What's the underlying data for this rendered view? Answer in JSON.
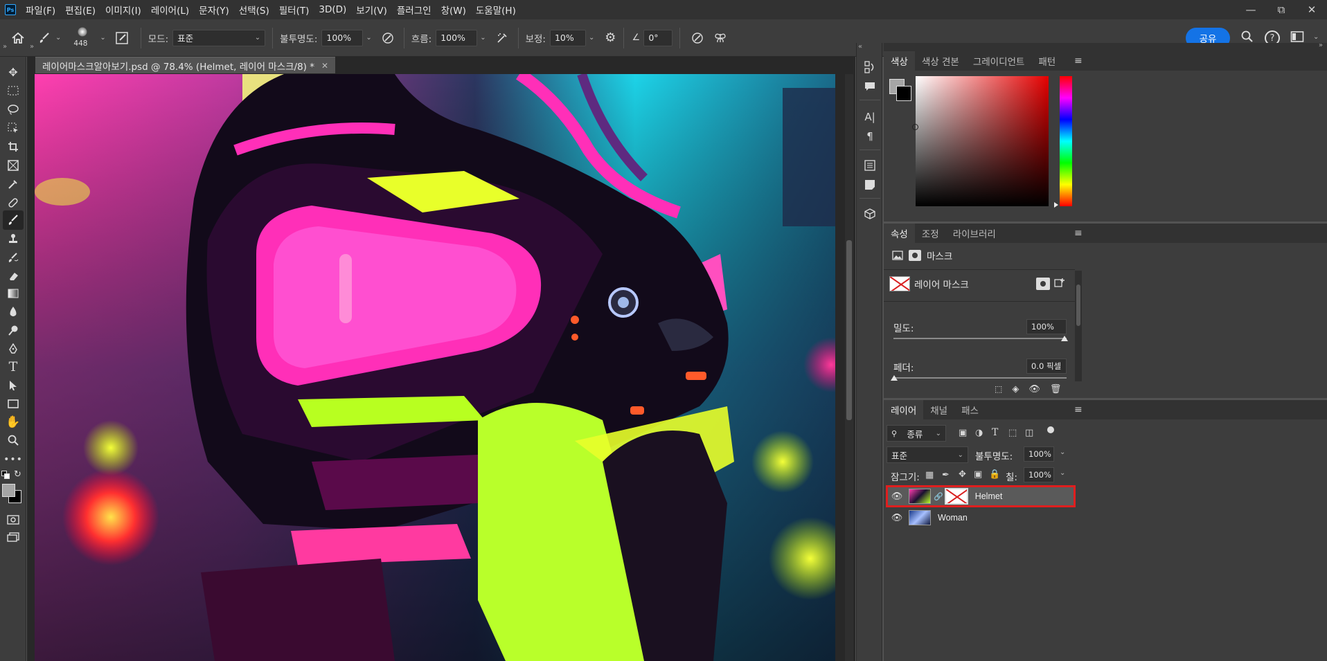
{
  "menu": [
    "파일(F)",
    "편집(E)",
    "이미지(I)",
    "레이어(L)",
    "문자(Y)",
    "선택(S)",
    "필터(T)",
    "3D(D)",
    "보기(V)",
    "플러그인",
    "창(W)",
    "도움말(H)"
  ],
  "app_logo": "Ps",
  "window_controls": [
    "minimize-icon",
    "restore-icon",
    "close-icon"
  ],
  "options": {
    "brush_size": "448",
    "mode_label": "모드:",
    "mode_value": "표준",
    "opacity_label": "불투명도:",
    "opacity_value": "100%",
    "flow_label": "흐름:",
    "flow_value": "100%",
    "smoothing_label": "보정:",
    "smoothing_value": "10%",
    "angle_value": "0°",
    "share_label": "공유"
  },
  "document": {
    "tab_title": "레이어마스크알아보기.psd @ 78.4% (Helmet, 레이어 마스크/8) *"
  },
  "tools": [
    "move-tool",
    "marquee-tool",
    "lasso-tool",
    "object-select-tool",
    "crop-tool",
    "frame-tool",
    "eyedropper-tool",
    "healing-tool",
    "brush-tool",
    "stamp-tool",
    "history-brush-tool",
    "eraser-tool",
    "gradient-tool",
    "blur-tool",
    "dodge-tool",
    "pen-tool",
    "type-tool",
    "path-select-tool",
    "rectangle-tool",
    "hand-tool",
    "zoom-tool",
    "more-tools"
  ],
  "color_panel": {
    "tabs": [
      "색상",
      "색상 견본",
      "그레이디언트",
      "패턴"
    ],
    "fg_color": "#a6a6a6",
    "bg_color": "#000000"
  },
  "properties_panel": {
    "tabs": [
      "속성",
      "조정",
      "라이브러리"
    ],
    "mask_label": "마스크",
    "layer_mask_label": "레이어 마스크",
    "density_label": "밀도:",
    "density_value": "100%",
    "feather_label": "페더:",
    "feather_value": "0.0 픽셀"
  },
  "layers_panel": {
    "tabs": [
      "레이어",
      "채널",
      "패스"
    ],
    "filter_label": "종류",
    "blend_mode": "표준",
    "opacity_label": "불투명도:",
    "opacity_value": "100%",
    "lock_label": "잠그기:",
    "fill_label": "칠:",
    "fill_value": "100%",
    "layers": [
      {
        "name": "Helmet",
        "visible": true,
        "selected": true,
        "has_mask": true
      },
      {
        "name": "Woman",
        "visible": true,
        "selected": false,
        "has_mask": false
      }
    ]
  }
}
